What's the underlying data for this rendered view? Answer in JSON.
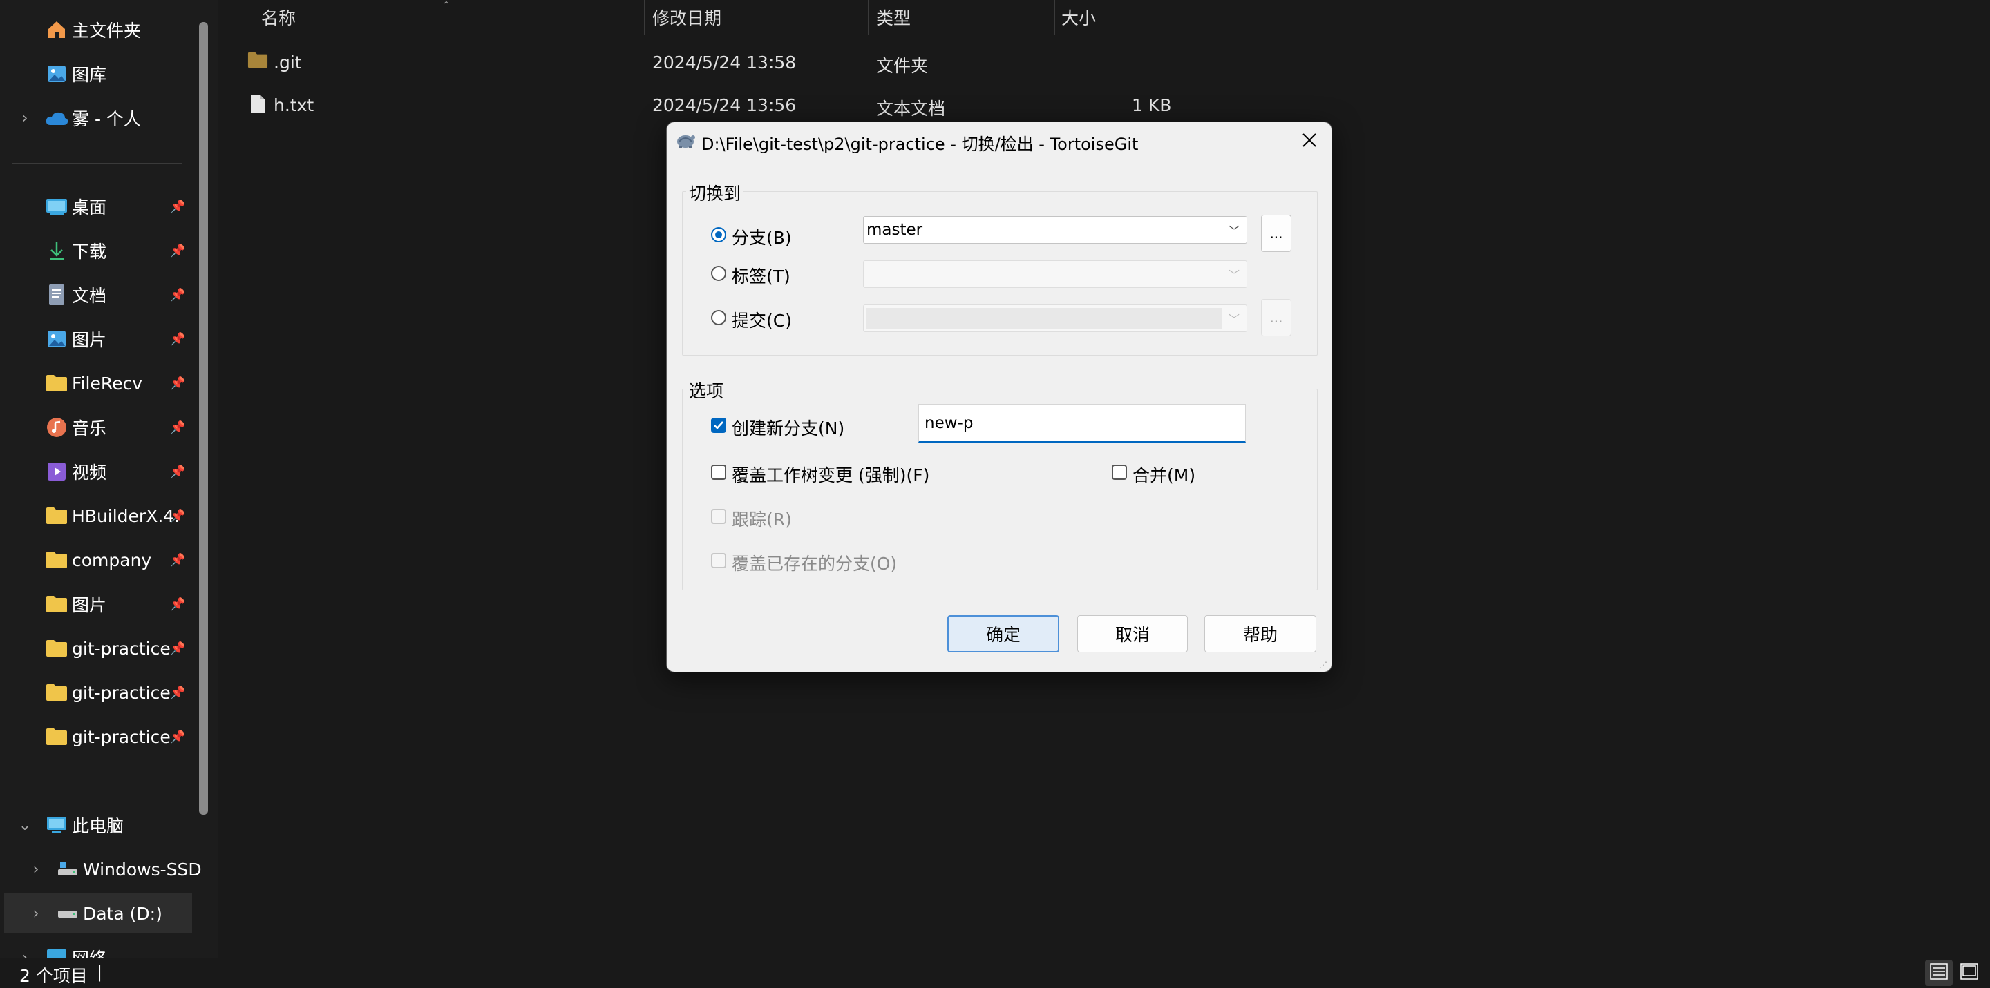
{
  "sidebar": {
    "items": [
      {
        "label": "主文件夹",
        "icon": "home-icon"
      },
      {
        "label": "图库",
        "icon": "gallery-icon"
      },
      {
        "label": "雾 - 个人",
        "icon": "onedrive-cloud-icon"
      },
      {
        "label": "桌面",
        "icon": "desktop-icon"
      },
      {
        "label": "下载",
        "icon": "download-icon"
      },
      {
        "label": "文档",
        "icon": "document-icon"
      },
      {
        "label": "图片",
        "icon": "pictures-icon"
      },
      {
        "label": "FileRecv",
        "icon": "folder-icon"
      },
      {
        "label": "音乐",
        "icon": "music-icon"
      },
      {
        "label": "视频",
        "icon": "video-icon"
      },
      {
        "label": "HBuilderX.4.",
        "icon": "folder-icon"
      },
      {
        "label": "company",
        "icon": "folder-icon"
      },
      {
        "label": "图片",
        "icon": "folder-icon"
      },
      {
        "label": "git-practice",
        "icon": "folder-icon"
      },
      {
        "label": "git-practice",
        "icon": "folder-icon"
      },
      {
        "label": "git-practice",
        "icon": "folder-icon"
      },
      {
        "label": "此电脑",
        "icon": "computer-icon"
      },
      {
        "label": "Windows-SSD",
        "icon": "drive-icon"
      },
      {
        "label": "Data (D:)",
        "icon": "drive-icon"
      },
      {
        "label": "网络",
        "icon": "network-icon"
      }
    ]
  },
  "file_list": {
    "columns": [
      "名称",
      "修改日期",
      "类型",
      "大小"
    ],
    "rows": [
      {
        "name": ".git",
        "date": "2024/5/24 13:58",
        "type": "文件夹",
        "size": "",
        "icon": "folder-icon"
      },
      {
        "name": "h.txt",
        "date": "2024/5/24 13:56",
        "type": "文本文档",
        "size": "1 KB",
        "icon": "text-file-icon"
      }
    ]
  },
  "status_bar": {
    "item_count": "2 个项目"
  },
  "dialog": {
    "title": "D:\\File\\git-test\\p2\\git-practice - 切换/检出 - TortoiseGit",
    "switch_to": {
      "heading": "切换到",
      "branch_label": "分支(B)",
      "branch_value": "master",
      "tag_label": "标签(T)",
      "commit_label": "提交(C)",
      "dots": "..."
    },
    "options": {
      "heading": "选项",
      "create_branch_label": "创建新分支(N)",
      "create_branch_value": "new-p",
      "force_label": "覆盖工作树变更 (强制)(F)",
      "merge_label": "合并(M)",
      "track_label": "跟踪(R)",
      "override_label": "覆盖已存在的分支(O)"
    },
    "buttons": {
      "ok": "确定",
      "cancel": "取消",
      "help": "帮助"
    }
  },
  "colors": {
    "accent": "#0067c0",
    "folder": "#f0c54a",
    "background": "#191919"
  }
}
